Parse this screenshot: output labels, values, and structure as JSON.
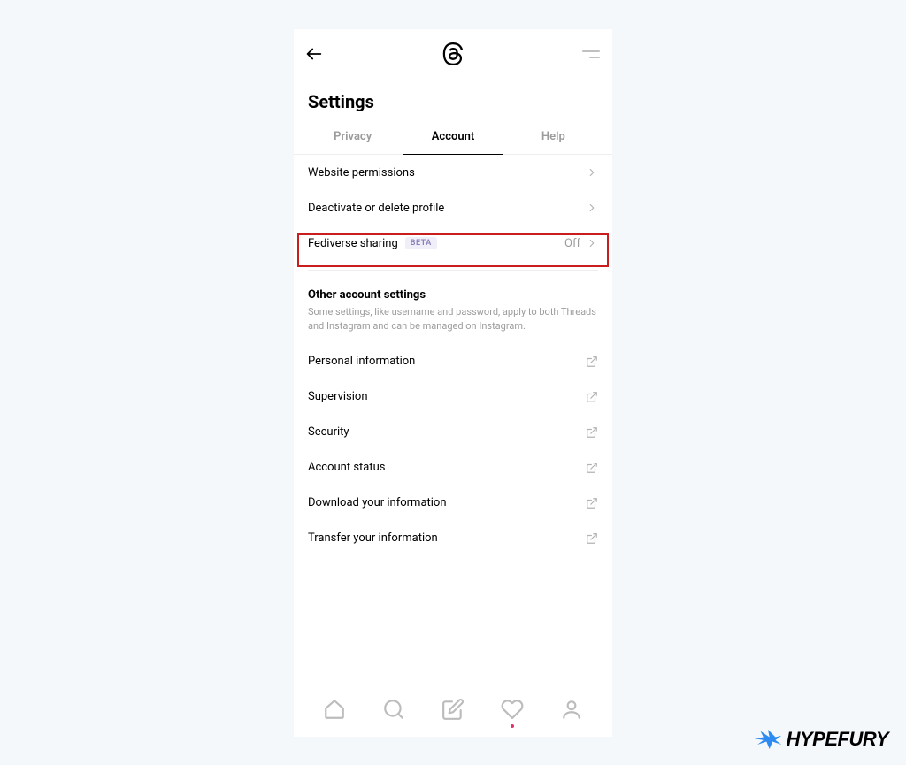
{
  "page_title": "Settings",
  "tabs": [
    {
      "label": "Privacy",
      "active": false
    },
    {
      "label": "Account",
      "active": true
    },
    {
      "label": "Help",
      "active": false
    }
  ],
  "account_items": [
    {
      "label": "Website permissions"
    },
    {
      "label": "Deactivate or delete profile",
      "highlighted": true
    },
    {
      "label": "Fediverse sharing",
      "badge": "BETA",
      "value": "Off"
    }
  ],
  "other_section": {
    "title": "Other account settings",
    "description": "Some settings, like username and password, apply to both Threads and Instagram and can be managed on Instagram."
  },
  "other_items": [
    {
      "label": "Personal information"
    },
    {
      "label": "Supervision"
    },
    {
      "label": "Security"
    },
    {
      "label": "Account status"
    },
    {
      "label": "Download your information"
    },
    {
      "label": "Transfer your information"
    }
  ],
  "badge_text": "HYPEFURY",
  "colors": {
    "highlight_border": "#c81e1e",
    "badge_blue": "#2c8af0"
  }
}
